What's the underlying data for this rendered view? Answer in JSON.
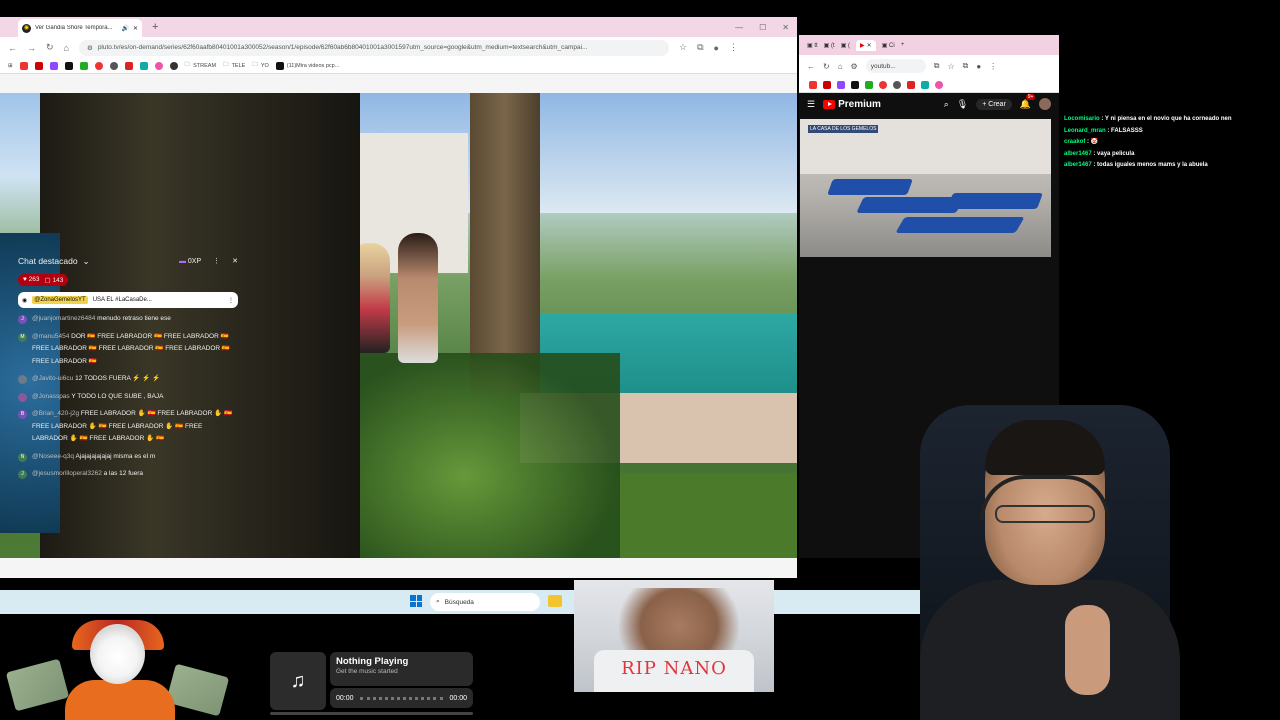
{
  "left_browser": {
    "tab_title": "Ver Gandia Shore Tempora...",
    "tab_favicon": "pluto-tv-icon",
    "new_tab": "+",
    "url": "pluto.tv/es/on-demand/series/62f60aafb80401001a300052/season/1/episode/62f60ab6b80401001a3001597utm_source=google&utm_medium=textsearch&utm_campai...",
    "bookmarks": [
      {
        "label": "STREAM"
      },
      {
        "label": "TELE"
      },
      {
        "label": "YO"
      },
      {
        "label": "(11)Mira videos pcp..."
      }
    ]
  },
  "right_browser": {
    "address": "youtub...",
    "youtube_logo": "Premium",
    "create_label": "Crear",
    "notification_badge": "9+",
    "live_logo": "LA CASA DE LOS GEMELOS",
    "chat": {
      "title": "Chat destacado",
      "xp": "0XP",
      "reactions": "263",
      "viewers": "143",
      "pinned_user": "@ZonaGemelosYT",
      "pinned_text": "USA EL #LaCasaDe...",
      "messages": [
        {
          "user": "@juanjomartinez6484",
          "text": "menudo retraso tiene ese",
          "avatar_letter": "J",
          "color": "#7b4fb8"
        },
        {
          "user": "@manu5454",
          "text": "DOR 🇪🇸 FREE LABRADOR 🇪🇸 FREE LABRADOR 🇪🇸 FREE LABRADOR 🇪🇸 FREE LABRADOR 🇪🇸 FREE LABRADOR 🇪🇸 FREE LABRADOR 🇪🇸",
          "avatar_letter": "M",
          "color": "#3f7b54"
        },
        {
          "user": "@Javito-ui6cu",
          "text": "12 TODOS FUERA ⚡ ⚡ ⚡",
          "avatar_letter": "",
          "color": "#6c7a8a"
        },
        {
          "user": "@Jonasspas",
          "text": "Y TODO LO QUE SUBE , BAJA",
          "avatar_letter": "",
          "color": "#8a5a9c"
        },
        {
          "user": "@Brian_420-j2g",
          "text": "FREE LABRADOR ✋ 🇪🇸 FREE LABRADOR ✋ 🇪🇸 FREE LABRADOR ✋ 🇪🇸 FREE LABRADOR ✋ 🇪🇸 FREE LABRADOR ✋ 🇪🇸 FREE LABRADOR ✋ 🇪🇸",
          "avatar_letter": "B",
          "color": "#7b4fb8"
        },
        {
          "user": "@Noseee-q3q",
          "text": "Ajajajajajajaj misma es el m",
          "avatar_letter": "N",
          "color": "#3f7b54"
        },
        {
          "user": "@jesusmorilloperal3262",
          "text": "a las 12 fuera",
          "avatar_letter": "J",
          "color": "#3f7b54"
        }
      ]
    }
  },
  "twitch_chat": [
    {
      "user": "Locomisario",
      "text": "Y ni piensa en el novio que ha corneado nen"
    },
    {
      "user": "Leonard_mran",
      "text": "FALSASSS"
    },
    {
      "user": "craakof",
      "text": "🤡"
    },
    {
      "user": "alber1467",
      "text": "vaya pelicula"
    },
    {
      "user": "alber1467",
      "text": "todas iguales menos mams y la abuela"
    }
  ],
  "taskbar": {
    "search_placeholder": "Búsqueda"
  },
  "music_widget": {
    "icon": "♫",
    "title": "Nothing Playing",
    "subtitle": "Get the music started",
    "time_start": "00:00",
    "time_end": "00:00"
  },
  "rip_overlay": {
    "text": "RIP NANO"
  }
}
